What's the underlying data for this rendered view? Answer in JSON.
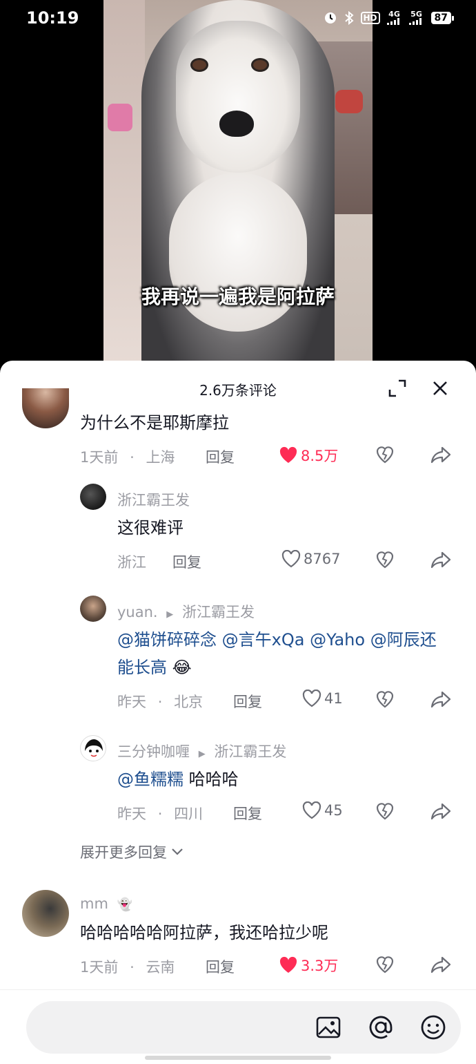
{
  "status_bar": {
    "time": "10:19",
    "hd_label": "HD",
    "net1": "4G",
    "net2": "5G",
    "battery": "87"
  },
  "video": {
    "subtitle": "我再说一遍我是阿拉萨"
  },
  "sheet": {
    "title": "2.6万条评论"
  },
  "comments": [
    {
      "text": "为什么不是耶斯摩拉",
      "time": "1天前",
      "location": "上海",
      "reply": "回复",
      "likes": "8.5万",
      "liked": true
    },
    {
      "name": "浙江霸王发",
      "text": "这很难评",
      "location": "浙江",
      "reply": "回复",
      "likes": "8767"
    },
    {
      "name": "yuan.",
      "reply_to": "浙江霸王发",
      "text_mentions": [
        "@猫饼碎碎念",
        "@言午xQa",
        "@Yaho",
        "@阿辰还能长高"
      ],
      "emoji": "😂",
      "time": "昨天",
      "location": "北京",
      "reply": "回复",
      "likes": "41"
    },
    {
      "name": "三分钟咖喱",
      "reply_to": "浙江霸王发",
      "mention": "@鱼糯糯",
      "text": "哈哈哈",
      "time": "昨天",
      "location": "四川",
      "reply": "回复",
      "likes": "45"
    },
    {
      "name": "mm",
      "name_emoji": "👻",
      "text": "哈哈哈哈哈阿拉萨，我还哈拉少呢",
      "time": "1天前",
      "location": "云南",
      "reply": "回复",
      "likes": "3.3万",
      "liked": true
    }
  ],
  "more_replies": "展开更多回复",
  "separator": "·",
  "colors": {
    "like_red": "#fe2c55",
    "mention_blue": "#1f4f8f",
    "meta_gray": "#9b9ca3"
  },
  "icons": [
    "expand-icon",
    "close-icon",
    "heart-icon",
    "dislike-icon",
    "share-icon",
    "image-icon",
    "at-icon",
    "emoji-icon",
    "chevron-down-icon"
  ]
}
